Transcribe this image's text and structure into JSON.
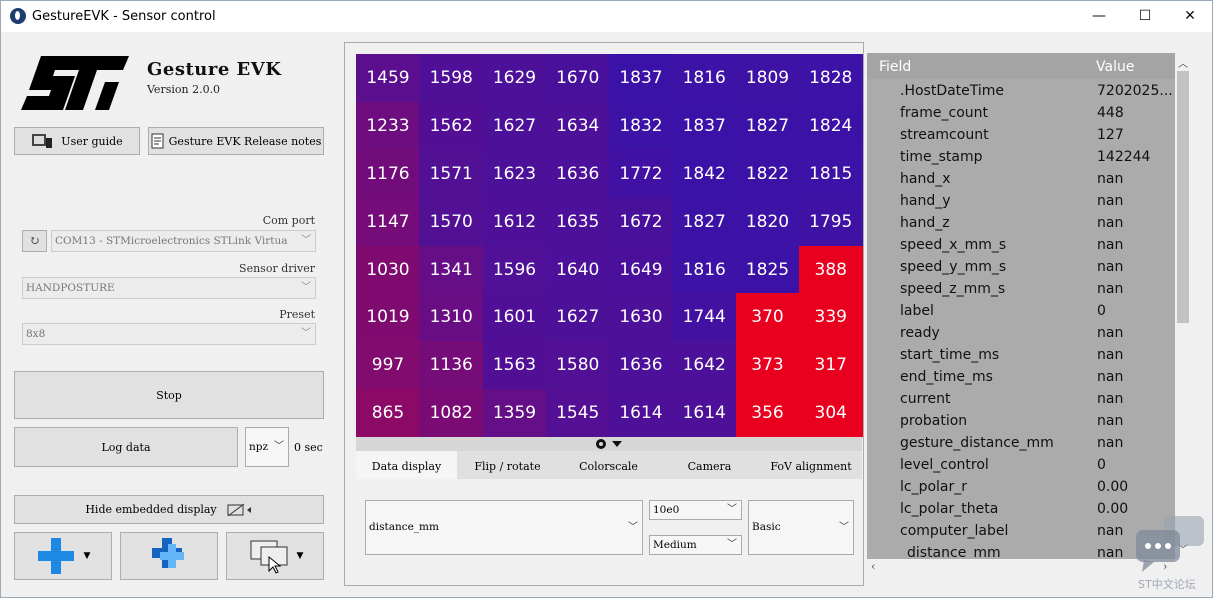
{
  "window": {
    "title": "GestureEVK - Sensor control",
    "minimize": "—",
    "maximize": "☐",
    "close": "✕"
  },
  "app": {
    "name": "Gesture EVK",
    "version": "Version 2.0.0"
  },
  "left": {
    "user_guide": "User guide",
    "release_notes": "Gesture EVK Release notes",
    "com_port_label": "Com port",
    "com_port_value": "COM13 - STMicroelectronics STLink Virtua",
    "refresh_icon": "↻",
    "sensor_driver_label": "Sensor driver",
    "sensor_driver_value": "HANDPOSTURE",
    "preset_label": "Preset",
    "preset_value": "8x8",
    "stop": "Stop",
    "log_data": "Log data",
    "log_format": "npz",
    "log_time": "0 sec",
    "hide_embedded": "Hide embedded display"
  },
  "grid": {
    "rows": [
      [
        1459,
        1598,
        1629,
        1670,
        1837,
        1816,
        1809,
        1828
      ],
      [
        1233,
        1562,
        1627,
        1634,
        1832,
        1837,
        1827,
        1824
      ],
      [
        1176,
        1571,
        1623,
        1636,
        1772,
        1842,
        1822,
        1815
      ],
      [
        1147,
        1570,
        1612,
        1635,
        1672,
        1827,
        1820,
        1795
      ],
      [
        1030,
        1341,
        1596,
        1640,
        1649,
        1816,
        1825,
        388
      ],
      [
        1019,
        1310,
        1601,
        1627,
        1630,
        1744,
        370,
        339
      ],
      [
        997,
        1136,
        1563,
        1580,
        1636,
        1642,
        373,
        317
      ],
      [
        865,
        1082,
        1359,
        1545,
        1614,
        1614,
        356,
        304
      ]
    ],
    "colors": {
      "far": "#3a12a8",
      "near": "#e8001e"
    }
  },
  "tabs": [
    "Data display",
    "Flip / rotate",
    "Colorscale",
    "Camera",
    "FoV alignment"
  ],
  "display": {
    "field": "distance_mm",
    "scale": "10e0",
    "size": "Medium",
    "mode": "Basic"
  },
  "table": {
    "header": {
      "field": "Field",
      "value": "Value"
    },
    "rows": [
      {
        "f": ".HostDateTime",
        "v": "7202025..."
      },
      {
        "f": "frame_count",
        "v": "448"
      },
      {
        "f": "streamcount",
        "v": "127"
      },
      {
        "f": "time_stamp",
        "v": "142244"
      },
      {
        "f": "hand_x",
        "v": "nan"
      },
      {
        "f": "hand_y",
        "v": "nan"
      },
      {
        "f": "hand_z",
        "v": "nan"
      },
      {
        "f": "speed_x_mm_s",
        "v": "nan"
      },
      {
        "f": "speed_y_mm_s",
        "v": "nan"
      },
      {
        "f": "speed_z_mm_s",
        "v": "nan"
      },
      {
        "f": "label",
        "v": "0"
      },
      {
        "f": "ready",
        "v": "nan"
      },
      {
        "f": "start_time_ms",
        "v": "nan"
      },
      {
        "f": "end_time_ms",
        "v": "nan"
      },
      {
        "f": "current",
        "v": "nan"
      },
      {
        "f": "probation",
        "v": "nan"
      },
      {
        "f": "gesture_distance_mm",
        "v": "nan"
      },
      {
        "f": "level_control",
        "v": "0"
      },
      {
        "f": "lc_polar_r",
        "v": "0.00"
      },
      {
        "f": "lc_polar_theta",
        "v": "0.00"
      },
      {
        "f": "computer_label",
        "v": "nan"
      },
      {
        "f": "_distance_mm",
        "v": "nan"
      }
    ]
  },
  "watermark": "ST中文论坛"
}
